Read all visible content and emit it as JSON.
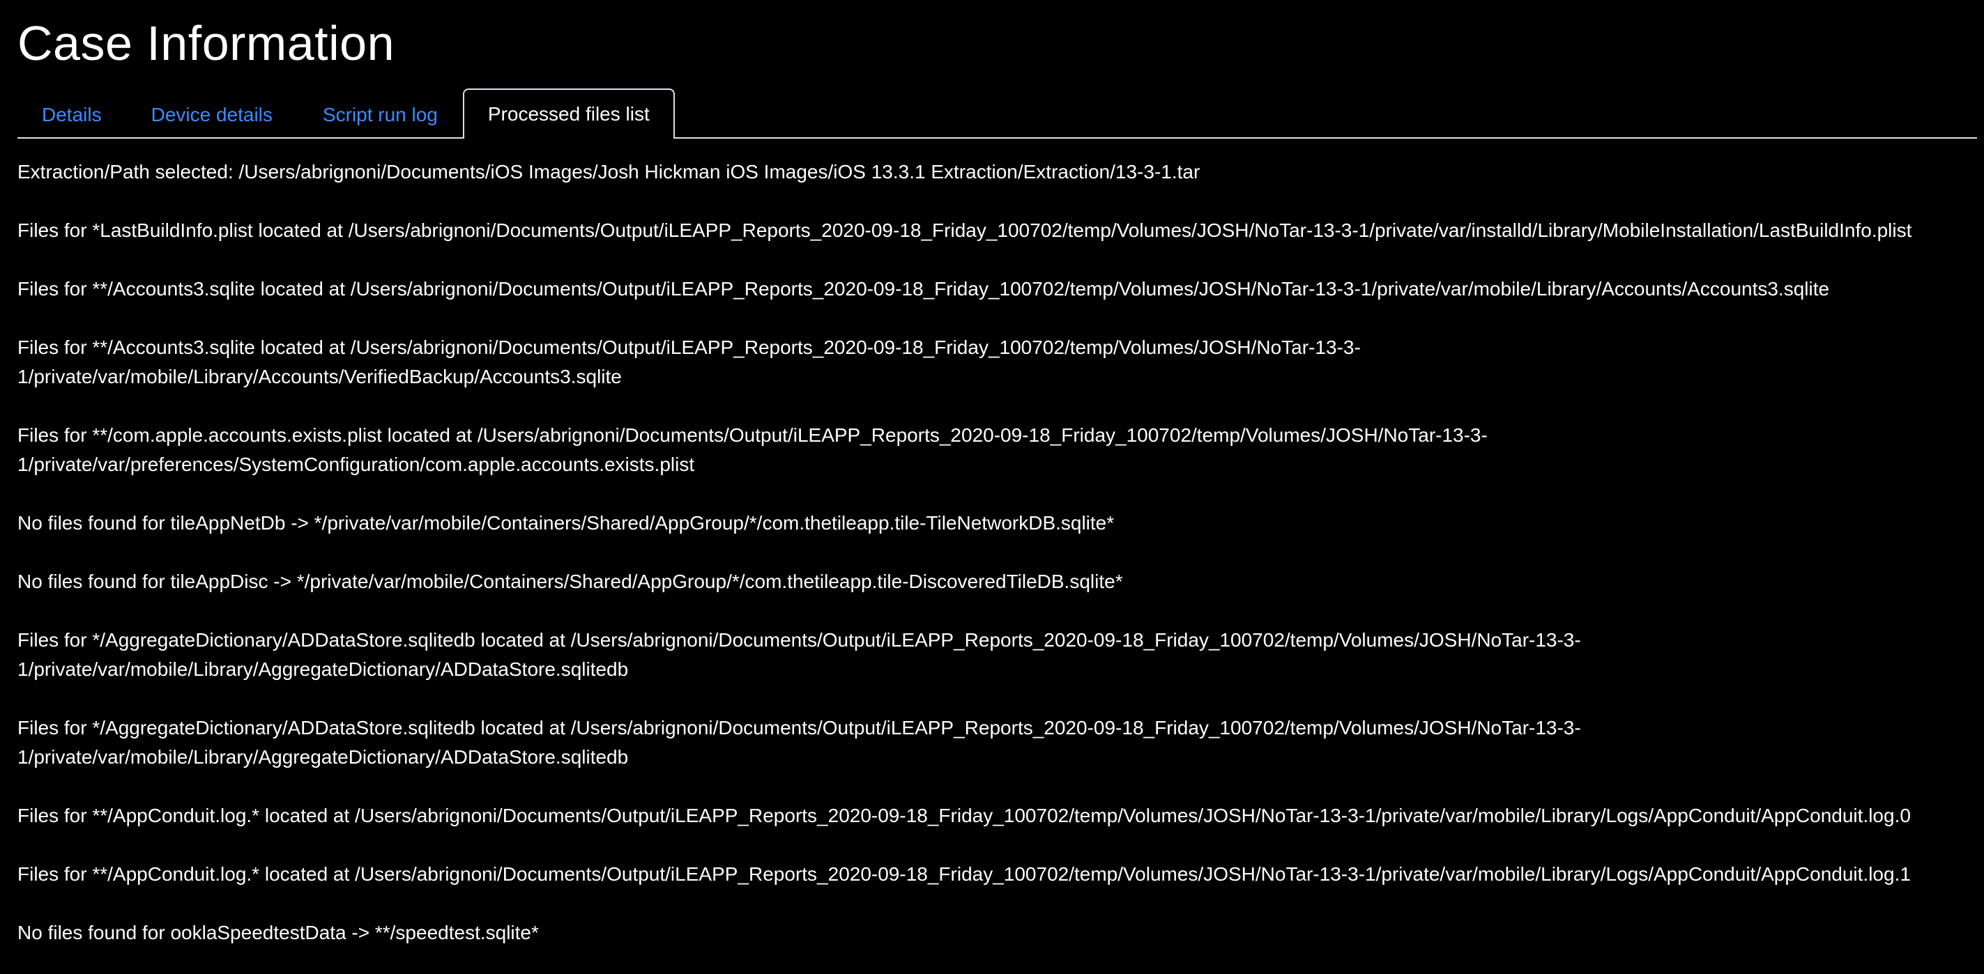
{
  "page": {
    "title": "Case Information"
  },
  "tabs": [
    {
      "label": "Details",
      "active": false
    },
    {
      "label": "Device details",
      "active": false
    },
    {
      "label": "Script run log",
      "active": false
    },
    {
      "label": "Processed files list",
      "active": true
    }
  ],
  "content": {
    "lines": [
      {
        "text": "Extraction/Path selected: /Users/abrignoni/Documents/iOS Images/Josh Hickman iOS Images/iOS 13.3.1 Extraction/Extraction/13-3-1.tar"
      },
      {
        "text": "Files for *LastBuildInfo.plist located at /Users/abrignoni/Documents/Output/iLEAPP_Reports_2020-09-18_Friday_100702/temp/Volumes/JOSH/NoTar-13-3-1/private/var/installd/Library/MobileInstallation/LastBuildInfo.plist"
      },
      {
        "text": "Files for **/Accounts3.sqlite located at /Users/abrignoni/Documents/Output/iLEAPP_Reports_2020-09-18_Friday_100702/temp/Volumes/JOSH/NoTar-13-3-1/private/var/mobile/Library/Accounts/Accounts3.sqlite"
      },
      {
        "line1": "Files for **/Accounts3.sqlite located at /Users/abrignoni/Documents/Output/iLEAPP_Reports_2020-09-18_Friday_100702/temp/Volumes/JOSH/NoTar-13-3-",
        "line2": "1/private/var/mobile/Library/Accounts/VerifiedBackup/Accounts3.sqlite"
      },
      {
        "line1": "Files for **/com.apple.accounts.exists.plist located at /Users/abrignoni/Documents/Output/iLEAPP_Reports_2020-09-18_Friday_100702/temp/Volumes/JOSH/NoTar-13-3-",
        "line2": "1/private/var/preferences/SystemConfiguration/com.apple.accounts.exists.plist"
      },
      {
        "text": "No files found for tileAppNetDb -> */private/var/mobile/Containers/Shared/AppGroup/*/com.thetileapp.tile-TileNetworkDB.sqlite*"
      },
      {
        "text": "No files found for tileAppDisc -> */private/var/mobile/Containers/Shared/AppGroup/*/com.thetileapp.tile-DiscoveredTileDB.sqlite*"
      },
      {
        "line1": "Files for */AggregateDictionary/ADDataStore.sqlitedb located at /Users/abrignoni/Documents/Output/iLEAPP_Reports_2020-09-18_Friday_100702/temp/Volumes/JOSH/NoTar-13-3-",
        "line2": "1/private/var/mobile/Library/AggregateDictionary/ADDataStore.sqlitedb"
      },
      {
        "line1": "Files for */AggregateDictionary/ADDataStore.sqlitedb located at /Users/abrignoni/Documents/Output/iLEAPP_Reports_2020-09-18_Friday_100702/temp/Volumes/JOSH/NoTar-13-3-",
        "line2": "1/private/var/mobile/Library/AggregateDictionary/ADDataStore.sqlitedb"
      },
      {
        "text": "Files for **/AppConduit.log.* located at /Users/abrignoni/Documents/Output/iLEAPP_Reports_2020-09-18_Friday_100702/temp/Volumes/JOSH/NoTar-13-3-1/private/var/mobile/Library/Logs/AppConduit/AppConduit.log.0"
      },
      {
        "text": "Files for **/AppConduit.log.* located at /Users/abrignoni/Documents/Output/iLEAPP_Reports_2020-09-18_Friday_100702/temp/Volumes/JOSH/NoTar-13-3-1/private/var/mobile/Library/Logs/AppConduit/AppConduit.log.1"
      },
      {
        "text": "No files found for ooklaSpeedtestData -> **/speedtest.sqlite*"
      }
    ]
  },
  "colors": {
    "background": "#000000",
    "text": "#ffffff",
    "link": "#3b8cff",
    "tab_border": "#dee2e6"
  }
}
